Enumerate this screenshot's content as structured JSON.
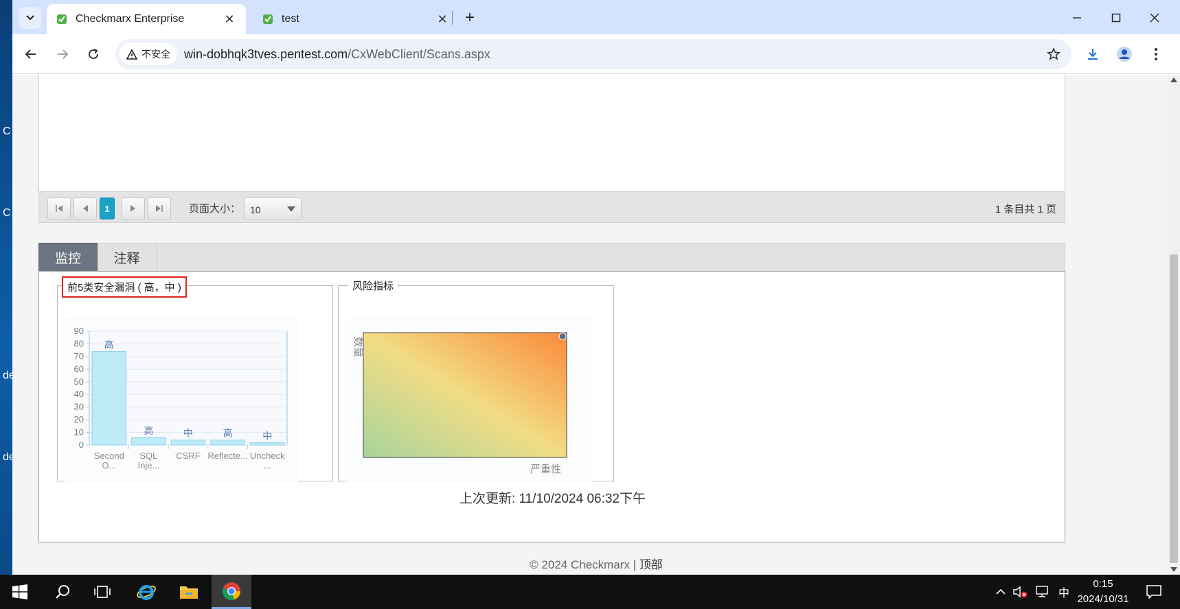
{
  "desktop": {
    "side_letters": [
      "C",
      "C",
      "de",
      "de"
    ]
  },
  "browser": {
    "tabs": [
      {
        "title": "Checkmarx Enterprise",
        "active": true
      },
      {
        "title": "test",
        "active": false
      }
    ],
    "new_tab_symbol": "+",
    "security_label": "不安全",
    "url_host": "win-dobhqk3tves.pentest.com",
    "url_path": "/CxWebClient/Scans.aspx"
  },
  "pager": {
    "current_page": "1",
    "page_size_label": "页面大小：",
    "page_size_value": "10",
    "info": "1 条目共 1 页"
  },
  "panel": {
    "tabs": [
      {
        "label": "监控",
        "active": true
      },
      {
        "label": "注释",
        "active": false
      }
    ],
    "top5_legend": "前5类安全漏洞 ( 高，中 )",
    "risk_legend": "风险指标",
    "last_updated": "上次更新: 11/10/2024 06:32下午"
  },
  "chart_data": [
    {
      "type": "bar",
      "categories": [
        "Second O...",
        "SQL Inje...",
        "CSRF",
        "Reflecte...",
        "Uncheck ..."
      ],
      "category_lines": [
        [
          "Second",
          "O..."
        ],
        [
          "SQL",
          "Inje..."
        ],
        [
          "CSRF"
        ],
        [
          "Reflecte..."
        ],
        [
          "Uncheck",
          "..."
        ]
      ],
      "values": [
        74,
        6,
        4,
        4,
        2
      ],
      "bar_labels": [
        "高",
        "高",
        "中",
        "高",
        "中"
      ],
      "ylim": [
        0,
        90
      ],
      "yticks": [
        0,
        10,
        20,
        30,
        40,
        50,
        60,
        70,
        80,
        90
      ],
      "grid": true,
      "bar_color": "#bfeaf7"
    },
    {
      "type": "scatter",
      "xlabel": "严重性",
      "ylabel": "数量",
      "xlim": [
        0,
        1
      ],
      "ylim": [
        0,
        1
      ],
      "points": [
        {
          "x": 0.98,
          "y": 0.97
        }
      ],
      "gradient": [
        "#a7d49c",
        "#f2dc84",
        "#fb8a3a"
      ],
      "point_color": "#5a6e8e"
    }
  ],
  "footer": {
    "copyright": "© 2024 Checkmarx | ",
    "top_link": "顶部"
  },
  "taskbar": {
    "ime": "中",
    "time": "0:15",
    "date": "2024/10/31"
  },
  "colors": {
    "tab_strip": "#d3e3fd",
    "pager_active": "#1ba1c6",
    "monitor_tab": "#6b7480",
    "highlight": "#e02020"
  }
}
